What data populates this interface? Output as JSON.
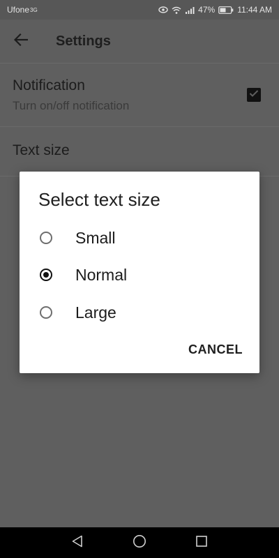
{
  "status_bar": {
    "carrier": "Ufone",
    "carrier_suffix": "3G",
    "battery": "47%",
    "time": "11:44 AM"
  },
  "app_bar": {
    "title": "Settings"
  },
  "settings": {
    "notification": {
      "title": "Notification",
      "summary": "Turn on/off notification",
      "checked": true
    },
    "text_size": {
      "title": "Text size"
    }
  },
  "dialog": {
    "title": "Select text size",
    "options": [
      {
        "label": "Small",
        "selected": false
      },
      {
        "label": "Normal",
        "selected": true
      },
      {
        "label": "Large",
        "selected": false
      }
    ],
    "cancel_label": "CANCEL"
  },
  "nav_bar": {
    "icons": [
      "back-icon",
      "home-icon",
      "recents-icon"
    ]
  }
}
